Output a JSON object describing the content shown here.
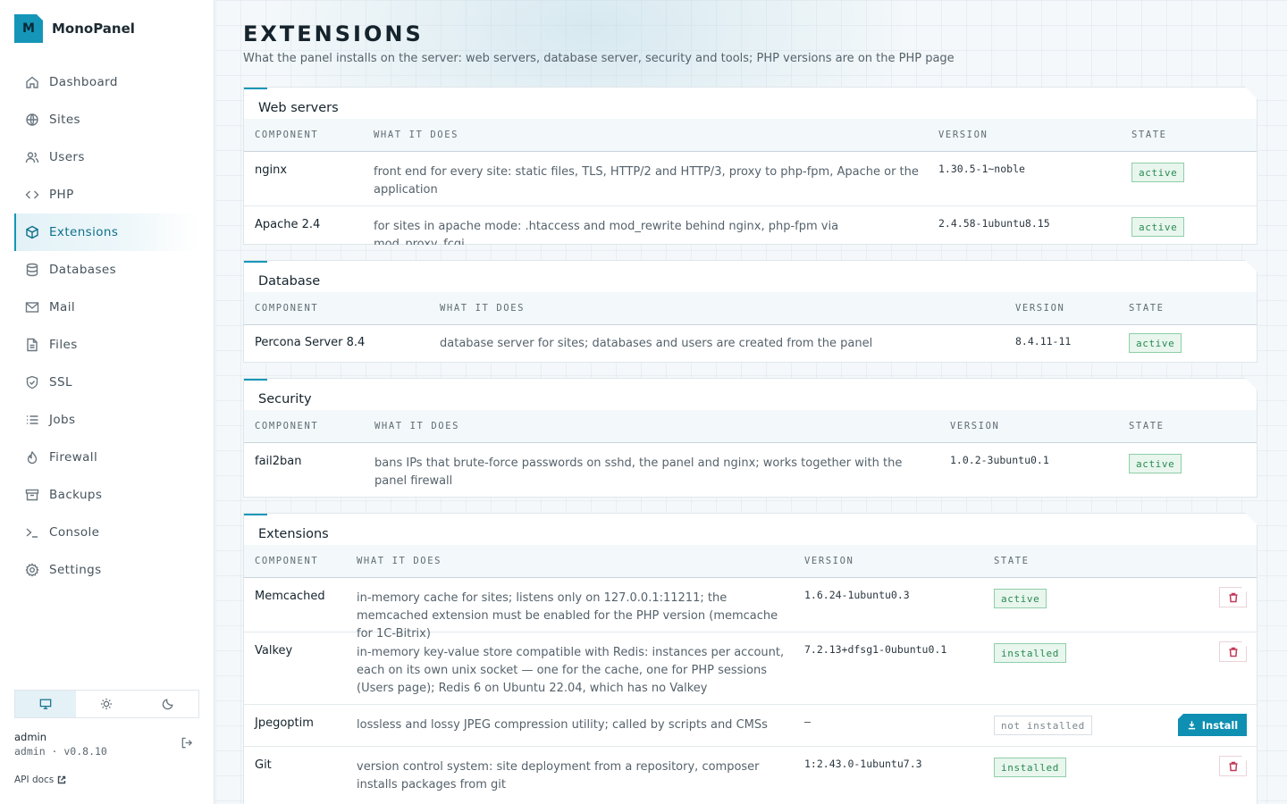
{
  "brand": {
    "logo_letter": "M",
    "name": "MonoPanel",
    "accent_color": "#1596b8"
  },
  "sidebar": {
    "items": [
      {
        "label": "Dashboard",
        "icon": "home-icon"
      },
      {
        "label": "Sites",
        "icon": "globe-icon"
      },
      {
        "label": "Users",
        "icon": "users-icon"
      },
      {
        "label": "PHP",
        "icon": "code-icon"
      },
      {
        "label": "Extensions",
        "icon": "package-icon",
        "active": true
      },
      {
        "label": "Databases",
        "icon": "database-icon"
      },
      {
        "label": "Mail",
        "icon": "mail-icon"
      },
      {
        "label": "Files",
        "icon": "file-icon"
      },
      {
        "label": "SSL",
        "icon": "shield-icon"
      },
      {
        "label": "Jobs",
        "icon": "list-icon"
      },
      {
        "label": "Firewall",
        "icon": "flame-icon"
      },
      {
        "label": "Backups",
        "icon": "archive-icon"
      },
      {
        "label": "Console",
        "icon": "terminal-icon"
      },
      {
        "label": "Settings",
        "icon": "gear-icon"
      }
    ],
    "theme_options": [
      "monitor-icon",
      "sun-icon",
      "moon-icon"
    ],
    "theme_selected": "monitor-icon",
    "user": {
      "name": "admin",
      "meta": "admin · v0.8.10"
    },
    "api_docs_label": "API docs"
  },
  "page": {
    "title": "EXTENSIONS",
    "subtitle": "What the panel installs on the server: web servers, database server, security and tools; PHP versions are on the PHP page"
  },
  "columns": {
    "component": "COMPONENT",
    "what": "WHAT IT DOES",
    "version": "VERSION",
    "state": "STATE"
  },
  "sections": [
    {
      "title": "Web servers",
      "rows": [
        {
          "name": "nginx",
          "desc": "front end for every site: static files, TLS, HTTP/2 and HTTP/3, proxy to php-fpm, Apache or the application",
          "version": "1.30.5-1~noble",
          "state": "active"
        },
        {
          "name": "Apache 2.4",
          "desc": "for sites in apache mode: .htaccess and mod_rewrite behind nginx, php-fpm via mod_proxy_fcgi",
          "version": "2.4.58-1ubuntu8.15",
          "state": "active"
        }
      ]
    },
    {
      "title": "Database",
      "rows": [
        {
          "name": "Percona Server 8.4",
          "desc": "database server for sites; databases and users are created from the panel",
          "version": "8.4.11-11",
          "state": "active"
        }
      ]
    },
    {
      "title": "Security",
      "rows": [
        {
          "name": "fail2ban",
          "desc": "bans IPs that brute-force passwords on sshd, the panel and nginx; works together with the panel firewall",
          "version": "1.0.2-3ubuntu0.1",
          "state": "active"
        }
      ]
    },
    {
      "title": "Extensions",
      "rows": [
        {
          "name": "Memcached",
          "desc": "in-memory cache for sites; listens only on 127.0.0.1:11211; the memcached extension must be enabled for the PHP version (memcache for 1C-Bitrix)",
          "version": "1.6.24-1ubuntu0.3",
          "state": "active",
          "action": "delete"
        },
        {
          "name": "Valkey",
          "desc": "in-memory key-value store compatible with Redis: instances per account, each on its own unix socket — one for the cache, one for PHP sessions (Users page); Redis 6 on Ubuntu 22.04, which has no Valkey",
          "version": "7.2.13+dfsg1-0ubuntu0.1",
          "state": "installed",
          "action": "delete"
        },
        {
          "name": "Jpegoptim",
          "desc": "lossless and lossy JPEG compression utility; called by scripts and CMSs",
          "version": "—",
          "state": "not installed",
          "action": "install",
          "action_label": "Install"
        },
        {
          "name": "Git",
          "desc": "version control system: site deployment from a repository, composer installs packages from git",
          "version": "1:2.43.0-1ubuntu7.3",
          "state": "installed",
          "action": "delete"
        }
      ]
    }
  ]
}
